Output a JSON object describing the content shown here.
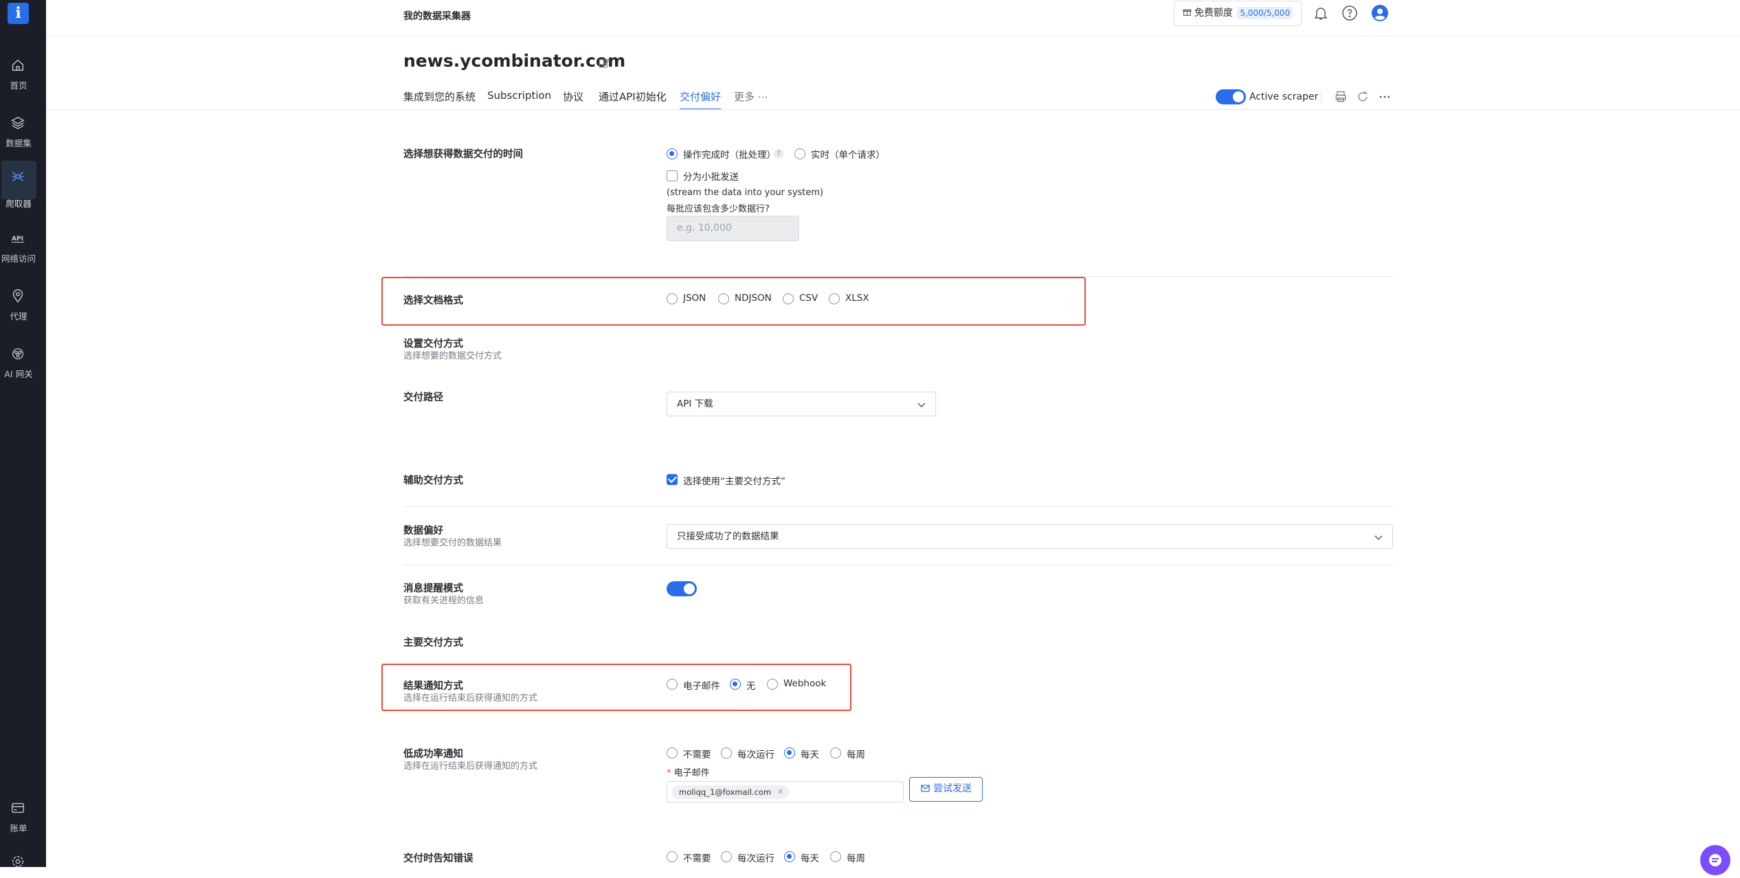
{
  "sidebar": {
    "logo": "i",
    "items": [
      {
        "label": "首页",
        "icon": "home-icon"
      },
      {
        "label": "数据集",
        "icon": "layers-icon"
      },
      {
        "label": "爬取器",
        "icon": "spider-icon"
      },
      {
        "label": "网络访问",
        "icon": "api-icon"
      },
      {
        "label": "代理",
        "icon": "location-pin-icon"
      },
      {
        "label": "AI 网关",
        "icon": "ai-gateway-icon"
      },
      {
        "label": "账单",
        "icon": "billing-card-icon"
      }
    ],
    "active": "爬取器"
  },
  "header": {
    "app_title": "我的数据采集器",
    "quota_label": "免费额度",
    "quota_value": "5,000/5,000"
  },
  "page": {
    "title": "news.ycombinator.com",
    "tabs": [
      "集成到您的系统",
      "Subscription",
      "协议",
      "通过API初始化",
      "交付偏好",
      "更多"
    ],
    "active_tab": "交付偏好",
    "active_scraper_label": "Active scraper",
    "active_scraper_on": true
  },
  "delivery_time": {
    "label": "选择想获得数据交付的时间",
    "option_batch": "操作完成时（批处理）",
    "option_realtime": "实时（单个请求）",
    "selected": "batch",
    "split_label": "分为小批发送",
    "split_checked": false,
    "stream_note": "(stream the data into your system)",
    "rows_question": "每批应该包含多少数据行?",
    "rows_placeholder": "e.g. 10,000"
  },
  "file_format": {
    "label": "选择文档格式",
    "options": [
      "JSON",
      "NDJSON",
      "CSV",
      "XLSX"
    ]
  },
  "delivery_method": {
    "label": "设置交付方式",
    "sub": "选择想要的数据交付方式"
  },
  "delivery_path": {
    "label": "交付路径",
    "value": "API 下载"
  },
  "aux_delivery": {
    "label": "辅助交付方式",
    "checkbox_label": "选择使用“主要交付方式”",
    "checked": true
  },
  "data_pref": {
    "label": "数据偏好",
    "sub": "选择想要交付的数据结果",
    "value": "只接受成功了的数据结果"
  },
  "notify_mode": {
    "label": "消息提醒模式",
    "sub": "获取有关进程的信息",
    "on": true
  },
  "main_delivery": {
    "label": "主要交付方式"
  },
  "result_notify": {
    "label": "结果通知方式",
    "sub": "选择在运行结束后获得通知的方式",
    "options": [
      "电子邮件",
      "无",
      "Webhook"
    ],
    "selected": "无"
  },
  "low_success": {
    "label": "低成功率通知",
    "sub": "选择在运行结束后获得通知的方式",
    "options": [
      "不需要",
      "每次运行",
      "每天",
      "每周"
    ],
    "selected": "每天",
    "email_label": "电子邮件",
    "email_tag": "moliqq_1@foxmail.com",
    "test_button": "尝试发送"
  },
  "delivery_error": {
    "label": "交付时告知错误",
    "options": [
      "不需要",
      "每次运行",
      "每天",
      "每周"
    ],
    "selected": "每天"
  }
}
